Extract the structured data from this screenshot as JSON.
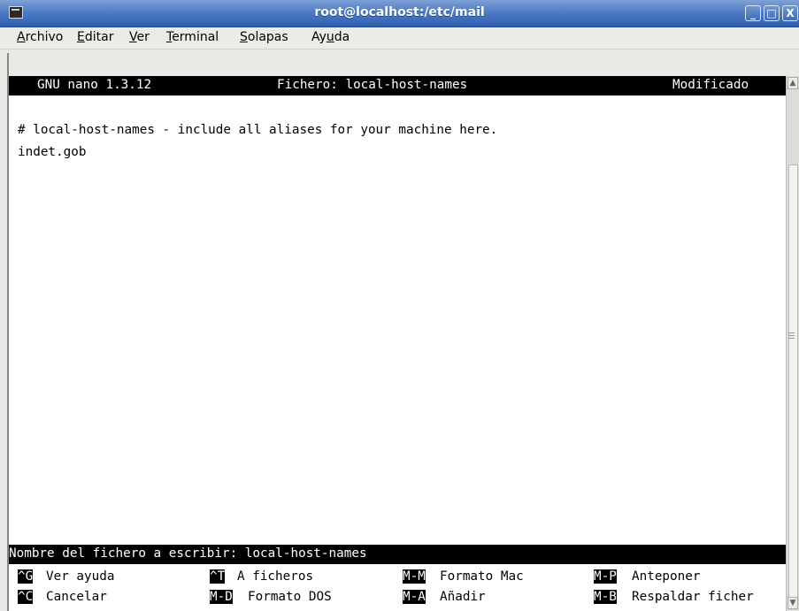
{
  "window": {
    "title": "root@localhost:/etc/mail",
    "buttons": {
      "minimize": "_",
      "maximize": "□",
      "close": "X"
    }
  },
  "menu": [
    {
      "pre": "",
      "u": "A",
      "post": "rchivo"
    },
    {
      "pre": "",
      "u": "E",
      "post": "ditar"
    },
    {
      "pre": "",
      "u": "V",
      "post": "er"
    },
    {
      "pre": "",
      "u": "T",
      "post": "erminal"
    },
    {
      "pre": "",
      "u": "S",
      "post": "olapas"
    },
    {
      "pre": "Ay",
      "u": "u",
      "post": "da"
    }
  ],
  "nano": {
    "version": "GNU nano 1.3.12",
    "file_label": "Fichero: local-host-names",
    "status": "Modificado",
    "lines": [
      "# local-host-names - include all aliases for your machine here.",
      "indet.gob"
    ],
    "prompt": "Nombre del fichero a escribir: local-host-names",
    "shortcuts_row1": [
      {
        "key": "^G",
        "label": "Ver ayuda"
      },
      {
        "key": "^T",
        "label": "A ficheros"
      },
      {
        "key": "M-M",
        "label": "Formato Mac"
      },
      {
        "key": "M-P",
        "label": "Anteponer"
      }
    ],
    "shortcuts_row2": [
      {
        "key": "^C",
        "label": "Cancelar"
      },
      {
        "key": "M-D",
        "label": "Formato DOS"
      },
      {
        "key": "M-A",
        "label": "Añadir"
      },
      {
        "key": "M-B",
        "label": "Respaldar ficher"
      }
    ]
  }
}
